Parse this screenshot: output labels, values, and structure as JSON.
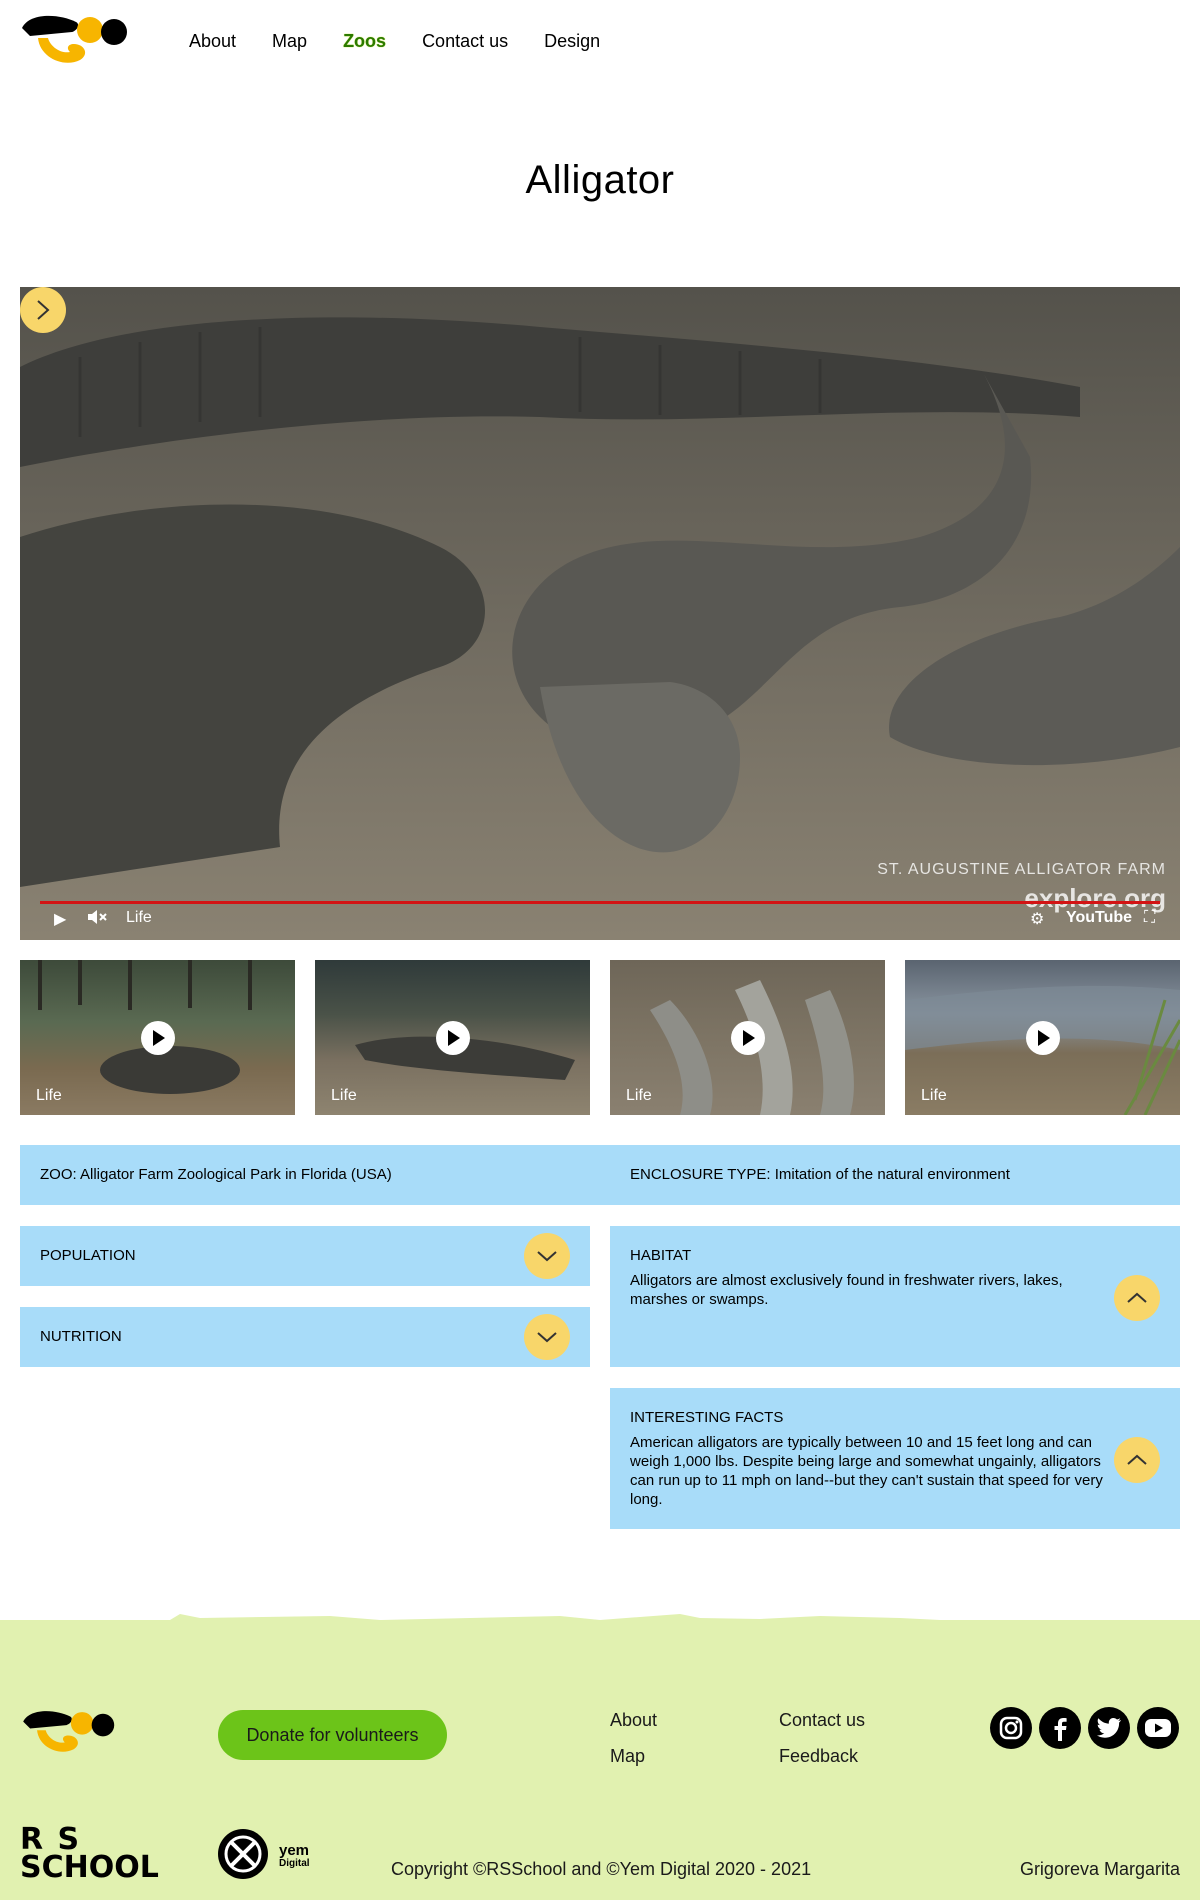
{
  "header": {
    "nav": [
      "About",
      "Map",
      "Zoos",
      "Contact us",
      "Design"
    ],
    "active": "Zoos"
  },
  "page": {
    "title": "Alligator"
  },
  "video": {
    "watermark_line1": "ST. AUGUSTINE ALLIGATOR FARM",
    "watermark_line2": "explore.org",
    "live_label": "Life",
    "youtube_label": "YouTube",
    "progress": 1.0
  },
  "thumbnails": [
    {
      "label": "Life"
    },
    {
      "label": "Life"
    },
    {
      "label": "Life"
    },
    {
      "label": "Life"
    }
  ],
  "info": {
    "zoo": "ZOO: Alligator Farm Zoological Park in Florida (USA)",
    "enclosure": "ENCLOSURE TYPE: Imitation of the natural environment",
    "population_label": "POPULATION",
    "nutrition_label": "NUTRITION",
    "habitat_label": "HABITAT",
    "habitat_text": "Alligators are almost exclusively found in freshwater rivers, lakes, marshes or swamps.",
    "facts_label": "INTERESTING FACTS",
    "facts_text": "American alligators are typically between 10 and 15 feet long and can weigh 1,000 lbs.  Despite being large and somewhat ungainly, alligators can run up to 11 mph on land--but they can't sustain that speed for very long."
  },
  "footer": {
    "donate_label": "Donate for volunteers",
    "links": {
      "about": "About",
      "map": "Map",
      "contact": "Contact us",
      "feedback": "Feedback"
    },
    "rs_logo_line1": "R  S",
    "rs_logo_line2": "SCHOOL",
    "yem_logo": "yem",
    "yem_logo_sub": "Digital",
    "copyright": "Copyright ©RSSchool and ©Yem Digital 2020 - 2021",
    "author": "Grigoreva Margarita",
    "social_icons": [
      "instagram-icon",
      "facebook-icon",
      "twitter-icon",
      "youtube-icon"
    ]
  },
  "colors": {
    "accent_yellow": "#f8d66a",
    "info_blue": "#a8dcf9",
    "footer_green": "#e1f1b0",
    "donate_green": "#6cc419",
    "nav_active": "#2b7a00"
  }
}
